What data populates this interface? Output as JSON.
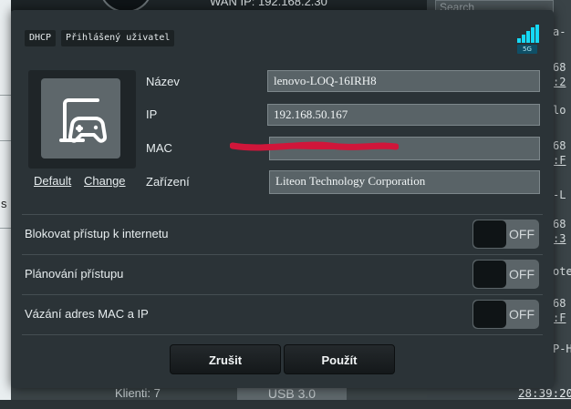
{
  "background": {
    "wan_ip_label": "WAN IP: 192.168.2.30",
    "search_placeholder": "Search",
    "left_cut_letter": "s",
    "clients_label": "Klienti: 7",
    "usb_label": "USB 3.0",
    "list_fragments": [
      "a-",
      "68",
      ":2",
      "lo",
      "68",
      ":F",
      "-L",
      "68",
      ":3",
      "ote",
      "68",
      ":F",
      "P-H",
      "68",
      "28:39:20"
    ]
  },
  "dialog": {
    "tags": [
      "DHCP",
      "Přihlášený uživatel"
    ],
    "wifi_band": "5G",
    "avatar_links": {
      "default": "Default",
      "change": "Change"
    },
    "fields": {
      "name": {
        "label": "Název",
        "value": "lenovo-LOQ-16IRH8"
      },
      "ip": {
        "label": "IP",
        "value": "192.168.50.167"
      },
      "mac": {
        "label": "MAC",
        "value": ""
      },
      "device": {
        "label": "Zařízení",
        "value": "Liteon Technology Corporation"
      }
    },
    "toggles": [
      {
        "label": "Blokovat přístup k internetu",
        "state": "OFF"
      },
      {
        "label": "Plánování přístupu",
        "state": "OFF"
      },
      {
        "label": "Vázání adres MAC a IP",
        "state": "OFF"
      }
    ],
    "buttons": {
      "cancel": "Zrušit",
      "apply": "Použít"
    }
  },
  "colors": {
    "accent_wifi": "#15d9f5",
    "redaction": "#d0163a",
    "dialog_bg": "#2b3337"
  }
}
